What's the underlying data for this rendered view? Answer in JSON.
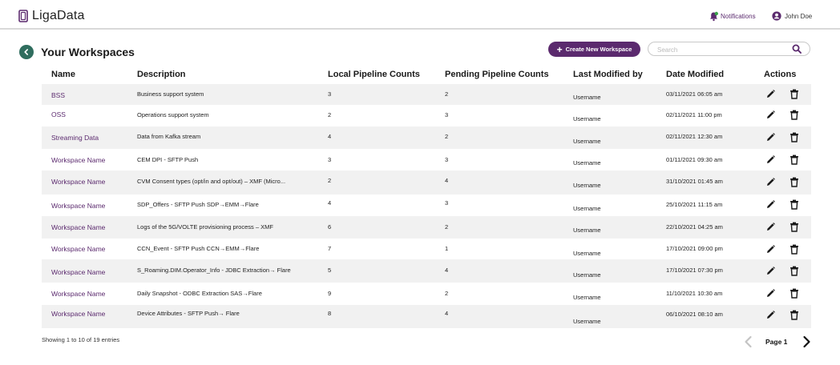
{
  "header": {
    "brand": "LigaData",
    "notifications_label": "Notifications",
    "user_name": "John Doe"
  },
  "page": {
    "title": "Your Workspaces",
    "create_button": "Create New Workspace",
    "search_placeholder": "Search"
  },
  "table": {
    "columns": [
      "Name",
      "Description",
      "Local Pipeline Counts",
      "Pending Pipeline Counts",
      "Last Modified by",
      "Date Modified",
      "Actions"
    ],
    "rows": [
      {
        "name": "BSS",
        "description": "Business support system",
        "local": "3",
        "pending": "2",
        "modified_by": "Username",
        "date": "03/11/2021 06:05 am"
      },
      {
        "name": "OSS",
        "description": "Operations support system",
        "local": "2",
        "pending": "3",
        "modified_by": "Username",
        "date": "02/11/2021 11:00 pm"
      },
      {
        "name": "Streaming Data",
        "description": "Data from Kafka stream",
        "local": "4",
        "pending": "2",
        "modified_by": "Username",
        "date": "02/11/2021 12:30 am"
      },
      {
        "name": "Workspace Name",
        "description": "CEM DPI - SFTP Push",
        "local": "3",
        "pending": "3",
        "modified_by": "Username",
        "date": "01/11/2021 09:30 am"
      },
      {
        "name": "Workspace Name",
        "description": "CVM Consent types (opt/in and opt/out) – XMF (Micro...",
        "local": "2",
        "pending": "4",
        "modified_by": "Username",
        "date": "31/10/2021 01:45 am"
      },
      {
        "name": "Workspace Name",
        "description": "SDP_Offers - SFTP Push SDP→EMM→Flare",
        "local": "4",
        "pending": "3",
        "modified_by": "Username",
        "date": "25/10/2021 11:15 am"
      },
      {
        "name": "Workspace Name",
        "description": "Logs of the 5G/VOLTE provisioning process – XMF",
        "local": "6",
        "pending": "2",
        "modified_by": "Username",
        "date": "22/10/2021 04:25 am"
      },
      {
        "name": "Workspace Name",
        "description": "CCN_Event - SFTP Push CCN→EMM→Flare",
        "local": "7",
        "pending": "1",
        "modified_by": "Username",
        "date": "17/10/2021 09:00 pm"
      },
      {
        "name": "Workspace Name",
        "description": "S_Roaming.DIM.Operator_Info - JDBC Extraction→ Flare",
        "local": "5",
        "pending": "4",
        "modified_by": "Username",
        "date": "17/10/2021 07:30 pm"
      },
      {
        "name": "Workspace Name",
        "description": "Daily Snapshot - ODBC Extraction SAS→Flare",
        "local": "9",
        "pending": "2",
        "modified_by": "Username",
        "date": "11/10/2021 10:30 am"
      },
      {
        "name": "Workspace Name",
        "description": "Device Attributes - SFTP Push→ Flare",
        "local": "8",
        "pending": "4",
        "modified_by": "Username",
        "date": "06/10/2021 08:10 am"
      }
    ]
  },
  "footer": {
    "entries_text": "Showing 1 to 10 of 19 entries",
    "page_label": "Page 1"
  },
  "colors": {
    "brand_purple": "#5b2a6e",
    "back_button_green": "#2f6d5e",
    "row_shade": "#f1f1f1"
  },
  "icons": [
    "bell-icon",
    "user-icon",
    "back-arrow-icon",
    "plus-icon",
    "search-icon",
    "edit-icon",
    "delete-icon",
    "chevron-left-icon",
    "chevron-right-icon"
  ]
}
